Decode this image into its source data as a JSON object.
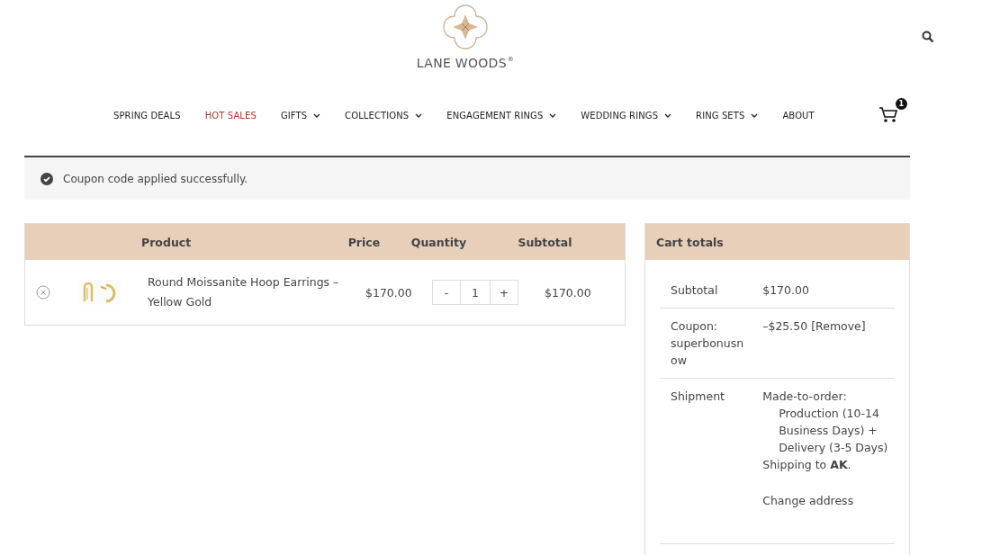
{
  "header": {
    "logo": {
      "text": "LANE WOODS",
      "mark": "®"
    }
  },
  "nav": [
    {
      "label": "SPRING DEALS",
      "accent": false,
      "has_menu": false
    },
    {
      "label": "HOT SALES",
      "accent": true,
      "has_menu": false
    },
    {
      "label": "GIFTS",
      "accent": false,
      "has_menu": true
    },
    {
      "label": "COLLECTIONS",
      "accent": false,
      "has_menu": true
    },
    {
      "label": "ENGAGEMENT RINGS",
      "accent": false,
      "has_menu": true
    },
    {
      "label": "WEDDING RINGS",
      "accent": false,
      "has_menu": true
    },
    {
      "label": "RING SETS",
      "accent": false,
      "has_menu": true
    },
    {
      "label": "ABOUT",
      "accent": false,
      "has_menu": false
    }
  ],
  "cart_badge": "1",
  "notice": "Coupon code applied successfully.",
  "cart_table": {
    "columns": [
      "Product",
      "Price",
      "Quantity",
      "Subtotal"
    ],
    "rows": [
      {
        "product": "Round Moissanite Hoop Earrings – Yellow Gold",
        "price": "$170.00",
        "quantity": "1",
        "minus": "-",
        "plus": "+",
        "subtotal": "$170.00"
      }
    ]
  },
  "cart_totals": {
    "title": "Cart totals",
    "subtotal_label": "Subtotal",
    "subtotal": "$170.00",
    "coupon_label": "Coupon: superbonusnow",
    "coupon_amount": "–$25.50",
    "coupon_remove": "[Remove]",
    "shipment_label": "Shipment",
    "shipment_method": "Made-to-order:",
    "shipment_detail": "Production (10-14 Business Days) + Delivery (3-5 Days)",
    "shipping_to": "Shipping to **AK**.",
    "change_address": "Change address"
  }
}
